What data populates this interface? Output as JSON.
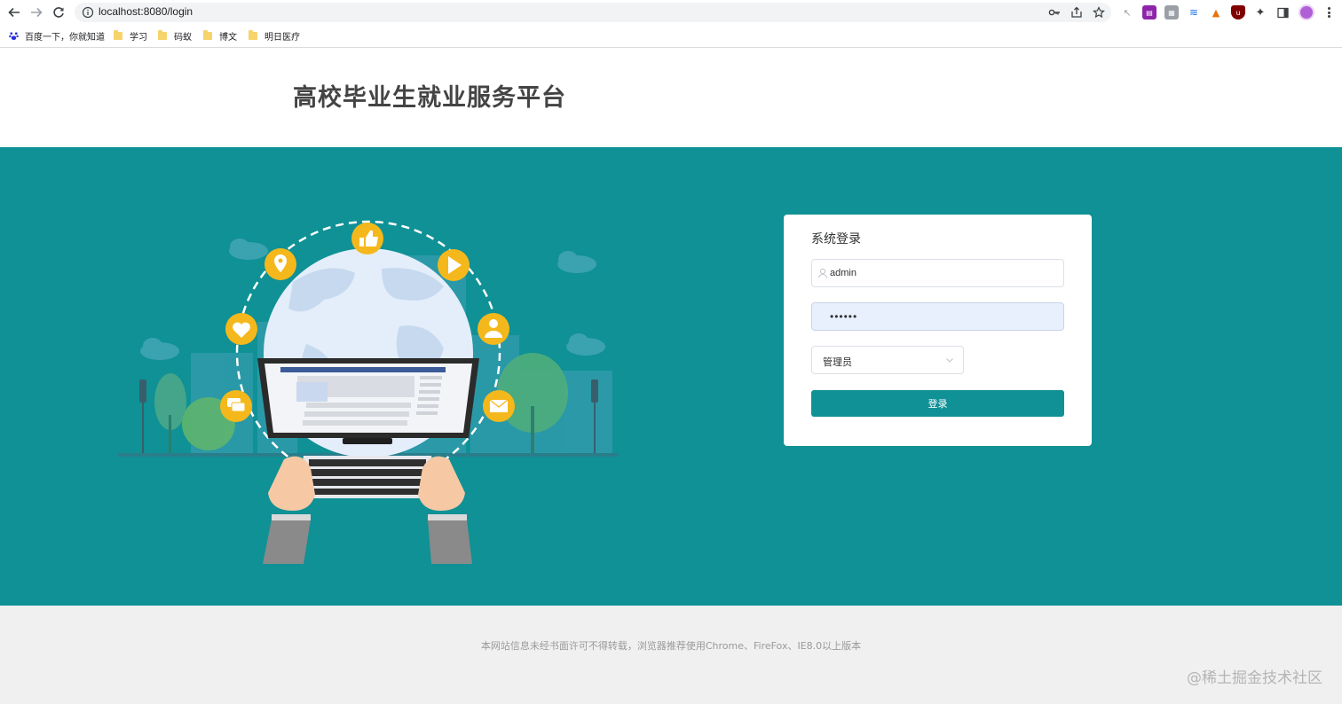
{
  "browser": {
    "url": "localhost:8080/login",
    "bookmarks": [
      {
        "label": "百度一下，你就知道",
        "icon": "baidu-paw-icon"
      },
      {
        "label": "学习",
        "icon": "folder-icon"
      },
      {
        "label": "码蚁",
        "icon": "folder-icon"
      },
      {
        "label": "博文",
        "icon": "folder-icon"
      },
      {
        "label": "明日医疗",
        "icon": "folder-icon"
      }
    ]
  },
  "header": {
    "title": "高校毕业生就业服务平台"
  },
  "login": {
    "title": "系统登录",
    "username_value": "admin",
    "password_value": "••••••",
    "role_selected": "管理员",
    "submit_label": "登录"
  },
  "footer": {
    "copyright": "本网站信息未经书面许可不得转载，浏览器推荐使用Chrome、FireFox、IE8.0以上版本",
    "watermark": "@稀土掘金技术社区"
  },
  "colors": {
    "brand_teal": "#0f9196",
    "accent_yellow": "#f5b81c",
    "autofill": "#e8f0fe"
  }
}
